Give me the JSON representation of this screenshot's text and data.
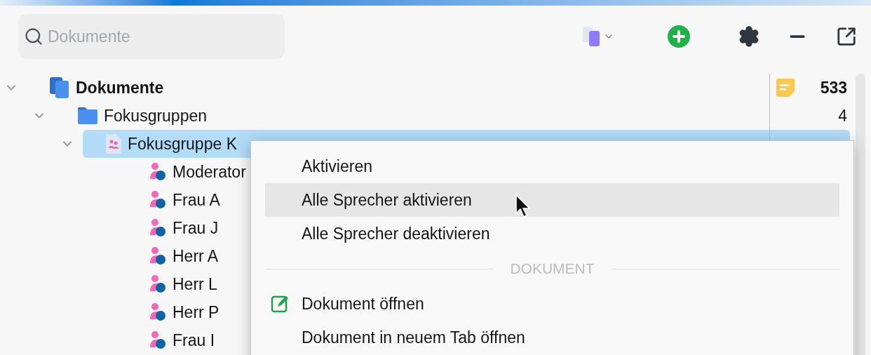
{
  "search": {
    "placeholder": "Dokumente"
  },
  "tree": [
    {
      "label": "Dokumente",
      "kind": "root",
      "count": "533",
      "expanded": true,
      "selected": false,
      "children": [
        {
          "label": "Fokusgruppen",
          "kind": "folder",
          "count": "4",
          "expanded": true,
          "selected": false,
          "children": [
            {
              "label": "Fokusgruppe K",
              "kind": "document",
              "expanded": true,
              "selected": true,
              "children": [
                {
                  "label": "Moderator",
                  "kind": "speaker",
                  "selected": false
                },
                {
                  "label": "Frau A",
                  "kind": "speaker",
                  "selected": false
                },
                {
                  "label": "Frau J",
                  "kind": "speaker",
                  "selected": false
                },
                {
                  "label": "Herr A",
                  "kind": "speaker",
                  "selected": false
                },
                {
                  "label": "Herr L",
                  "kind": "speaker",
                  "selected": false
                },
                {
                  "label": "Herr P",
                  "kind": "speaker",
                  "selected": false
                },
                {
                  "label": "Frau I",
                  "kind": "speaker",
                  "selected": false
                }
              ]
            }
          ]
        }
      ]
    }
  ],
  "context_menu": [
    {
      "kind": "item",
      "label": "Aktivieren",
      "highlighted": false
    },
    {
      "kind": "item",
      "label": "Alle Sprecher aktivieren",
      "highlighted": true
    },
    {
      "kind": "item",
      "label": "Alle Sprecher deaktivieren",
      "highlighted": false
    },
    {
      "kind": "section",
      "label": "DOKUMENT"
    },
    {
      "kind": "icon_item",
      "label": "Dokument öffnen",
      "highlighted": false
    },
    {
      "kind": "item",
      "label": "Dokument in neuem Tab öffnen",
      "highlighted": false
    }
  ]
}
